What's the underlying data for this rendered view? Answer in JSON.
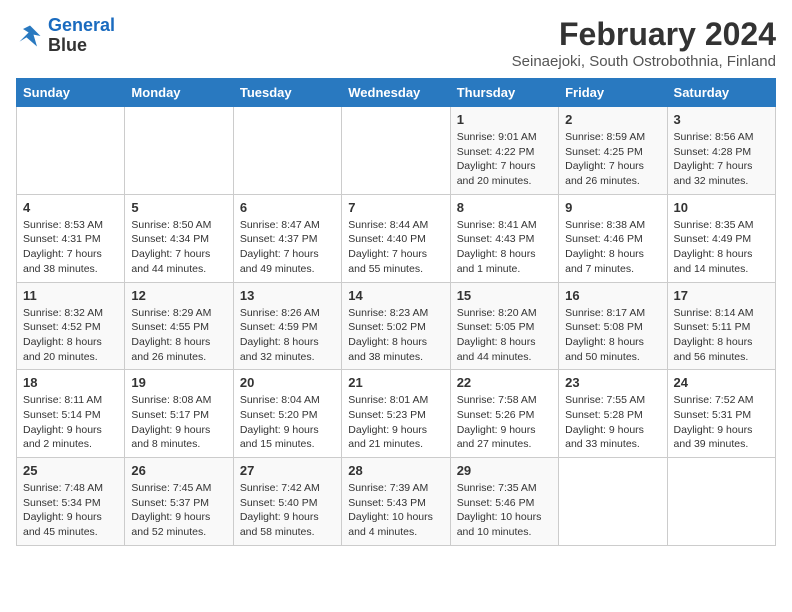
{
  "logo": {
    "line1": "General",
    "line2": "Blue"
  },
  "title": "February 2024",
  "subtitle": "Seinaejoki, South Ostrobothnia, Finland",
  "days_of_week": [
    "Sunday",
    "Monday",
    "Tuesday",
    "Wednesday",
    "Thursday",
    "Friday",
    "Saturday"
  ],
  "weeks": [
    [
      {
        "day": "",
        "info": ""
      },
      {
        "day": "",
        "info": ""
      },
      {
        "day": "",
        "info": ""
      },
      {
        "day": "",
        "info": ""
      },
      {
        "day": "1",
        "info": "Sunrise: 9:01 AM\nSunset: 4:22 PM\nDaylight: 7 hours\nand 20 minutes."
      },
      {
        "day": "2",
        "info": "Sunrise: 8:59 AM\nSunset: 4:25 PM\nDaylight: 7 hours\nand 26 minutes."
      },
      {
        "day": "3",
        "info": "Sunrise: 8:56 AM\nSunset: 4:28 PM\nDaylight: 7 hours\nand 32 minutes."
      }
    ],
    [
      {
        "day": "4",
        "info": "Sunrise: 8:53 AM\nSunset: 4:31 PM\nDaylight: 7 hours\nand 38 minutes."
      },
      {
        "day": "5",
        "info": "Sunrise: 8:50 AM\nSunset: 4:34 PM\nDaylight: 7 hours\nand 44 minutes."
      },
      {
        "day": "6",
        "info": "Sunrise: 8:47 AM\nSunset: 4:37 PM\nDaylight: 7 hours\nand 49 minutes."
      },
      {
        "day": "7",
        "info": "Sunrise: 8:44 AM\nSunset: 4:40 PM\nDaylight: 7 hours\nand 55 minutes."
      },
      {
        "day": "8",
        "info": "Sunrise: 8:41 AM\nSunset: 4:43 PM\nDaylight: 8 hours\nand 1 minute."
      },
      {
        "day": "9",
        "info": "Sunrise: 8:38 AM\nSunset: 4:46 PM\nDaylight: 8 hours\nand 7 minutes."
      },
      {
        "day": "10",
        "info": "Sunrise: 8:35 AM\nSunset: 4:49 PM\nDaylight: 8 hours\nand 14 minutes."
      }
    ],
    [
      {
        "day": "11",
        "info": "Sunrise: 8:32 AM\nSunset: 4:52 PM\nDaylight: 8 hours\nand 20 minutes."
      },
      {
        "day": "12",
        "info": "Sunrise: 8:29 AM\nSunset: 4:55 PM\nDaylight: 8 hours\nand 26 minutes."
      },
      {
        "day": "13",
        "info": "Sunrise: 8:26 AM\nSunset: 4:59 PM\nDaylight: 8 hours\nand 32 minutes."
      },
      {
        "day": "14",
        "info": "Sunrise: 8:23 AM\nSunset: 5:02 PM\nDaylight: 8 hours\nand 38 minutes."
      },
      {
        "day": "15",
        "info": "Sunrise: 8:20 AM\nSunset: 5:05 PM\nDaylight: 8 hours\nand 44 minutes."
      },
      {
        "day": "16",
        "info": "Sunrise: 8:17 AM\nSunset: 5:08 PM\nDaylight: 8 hours\nand 50 minutes."
      },
      {
        "day": "17",
        "info": "Sunrise: 8:14 AM\nSunset: 5:11 PM\nDaylight: 8 hours\nand 56 minutes."
      }
    ],
    [
      {
        "day": "18",
        "info": "Sunrise: 8:11 AM\nSunset: 5:14 PM\nDaylight: 9 hours\nand 2 minutes."
      },
      {
        "day": "19",
        "info": "Sunrise: 8:08 AM\nSunset: 5:17 PM\nDaylight: 9 hours\nand 8 minutes."
      },
      {
        "day": "20",
        "info": "Sunrise: 8:04 AM\nSunset: 5:20 PM\nDaylight: 9 hours\nand 15 minutes."
      },
      {
        "day": "21",
        "info": "Sunrise: 8:01 AM\nSunset: 5:23 PM\nDaylight: 9 hours\nand 21 minutes."
      },
      {
        "day": "22",
        "info": "Sunrise: 7:58 AM\nSunset: 5:26 PM\nDaylight: 9 hours\nand 27 minutes."
      },
      {
        "day": "23",
        "info": "Sunrise: 7:55 AM\nSunset: 5:28 PM\nDaylight: 9 hours\nand 33 minutes."
      },
      {
        "day": "24",
        "info": "Sunrise: 7:52 AM\nSunset: 5:31 PM\nDaylight: 9 hours\nand 39 minutes."
      }
    ],
    [
      {
        "day": "25",
        "info": "Sunrise: 7:48 AM\nSunset: 5:34 PM\nDaylight: 9 hours\nand 45 minutes."
      },
      {
        "day": "26",
        "info": "Sunrise: 7:45 AM\nSunset: 5:37 PM\nDaylight: 9 hours\nand 52 minutes."
      },
      {
        "day": "27",
        "info": "Sunrise: 7:42 AM\nSunset: 5:40 PM\nDaylight: 9 hours\nand 58 minutes."
      },
      {
        "day": "28",
        "info": "Sunrise: 7:39 AM\nSunset: 5:43 PM\nDaylight: 10 hours\nand 4 minutes."
      },
      {
        "day": "29",
        "info": "Sunrise: 7:35 AM\nSunset: 5:46 PM\nDaylight: 10 hours\nand 10 minutes."
      },
      {
        "day": "",
        "info": ""
      },
      {
        "day": "",
        "info": ""
      }
    ]
  ]
}
